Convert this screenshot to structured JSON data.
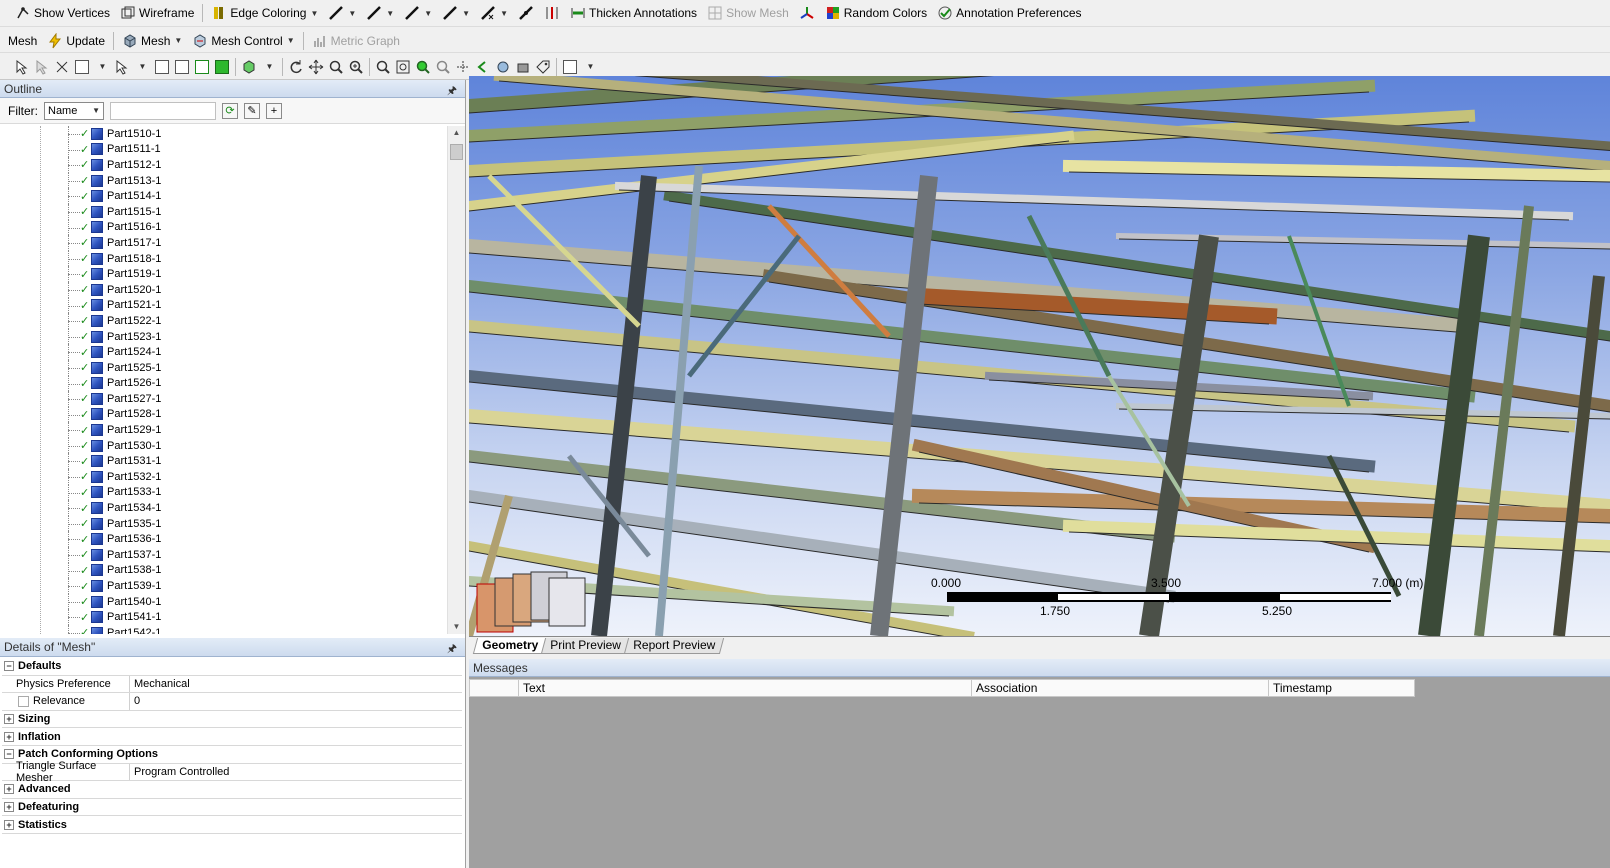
{
  "toolbar1": {
    "show_vertices": "Show Vertices",
    "wireframe": "Wireframe",
    "edge_coloring": "Edge Coloring",
    "thicken_annotations": "Thicken Annotations",
    "show_mesh": "Show Mesh",
    "random_colors": "Random Colors",
    "annotation_preferences": "Annotation Preferences"
  },
  "toolbar2": {
    "mesh": "Mesh",
    "update": "Update",
    "mesh_dropdown": "Mesh",
    "mesh_control": "Mesh Control",
    "metric_graph": "Metric Graph"
  },
  "outline": {
    "title": "Outline",
    "filter_label": "Filter:",
    "filter_value": "Name",
    "items": [
      "Part1510-1",
      "Part1511-1",
      "Part1512-1",
      "Part1513-1",
      "Part1514-1",
      "Part1515-1",
      "Part1516-1",
      "Part1517-1",
      "Part1518-1",
      "Part1519-1",
      "Part1520-1",
      "Part1521-1",
      "Part1522-1",
      "Part1523-1",
      "Part1524-1",
      "Part1525-1",
      "Part1526-1",
      "Part1527-1",
      "Part1528-1",
      "Part1529-1",
      "Part1530-1",
      "Part1531-1",
      "Part1532-1",
      "Part1533-1",
      "Part1534-1",
      "Part1535-1",
      "Part1536-1",
      "Part1537-1",
      "Part1538-1",
      "Part1539-1",
      "Part1540-1",
      "Part1541-1",
      "Part1542-1"
    ]
  },
  "details": {
    "title": "Details of \"Mesh\"",
    "rows": [
      {
        "type": "group",
        "expander": "−",
        "label": "Defaults"
      },
      {
        "type": "prop",
        "key": "Physics Preference",
        "value": "Mechanical"
      },
      {
        "type": "prop",
        "key": "Relevance",
        "value": "0",
        "checkbox": true
      },
      {
        "type": "group",
        "expander": "+",
        "label": "Sizing"
      },
      {
        "type": "group",
        "expander": "+",
        "label": "Inflation"
      },
      {
        "type": "group",
        "expander": "−",
        "label": "Patch Conforming Options"
      },
      {
        "type": "prop",
        "key": "Triangle Surface Mesher",
        "value": "Program Controlled"
      },
      {
        "type": "group",
        "expander": "+",
        "label": "Advanced"
      },
      {
        "type": "group",
        "expander": "+",
        "label": "Defeaturing"
      },
      {
        "type": "group",
        "expander": "+",
        "label": "Statistics"
      }
    ]
  },
  "scale": {
    "top_labels": [
      "0.000",
      "3.500",
      "7.000 (m)"
    ],
    "bottom_labels": [
      "1.750",
      "5.250"
    ]
  },
  "view_tabs": [
    "Geometry",
    "Print Preview",
    "Report Preview"
  ],
  "messages": {
    "title": "Messages",
    "columns": [
      "Text",
      "Association",
      "Timestamp"
    ]
  },
  "colors": {
    "accent_green": "#1a8a1a",
    "sky_top": "#5f84da",
    "sky_bottom": "#eef2fb"
  }
}
